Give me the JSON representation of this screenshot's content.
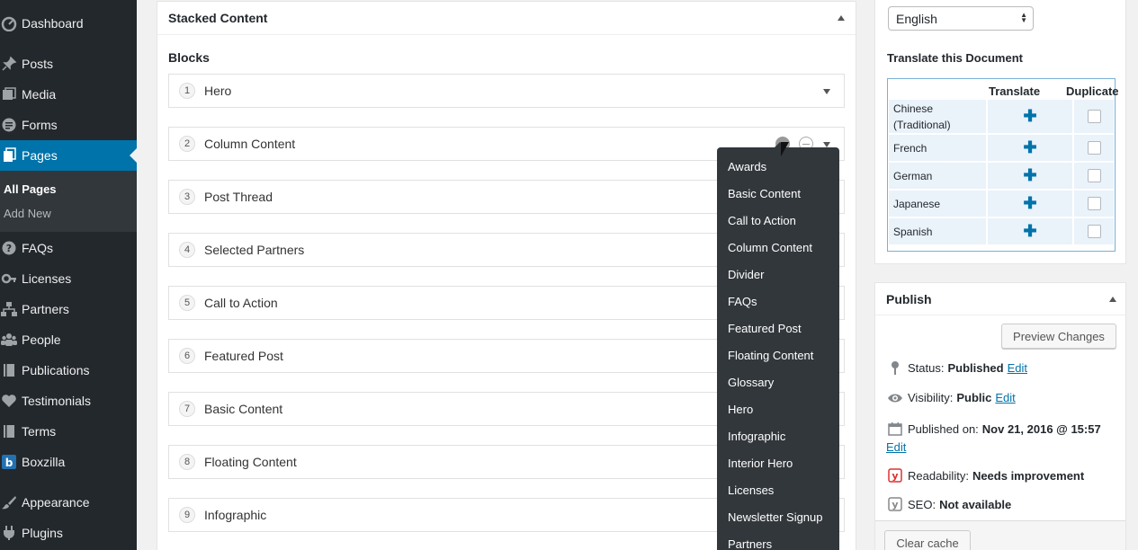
{
  "sidebar": {
    "items": [
      {
        "label": "Dashboard",
        "icon": "dashboard-icon"
      },
      {
        "label": "Posts",
        "icon": "pin-icon"
      },
      {
        "label": "Media",
        "icon": "media-icon"
      },
      {
        "label": "Forms",
        "icon": "forms-icon"
      },
      {
        "label": "Pages",
        "icon": "pages-icon"
      },
      {
        "label": "FAQs",
        "icon": "question-icon"
      },
      {
        "label": "Licenses",
        "icon": "key-icon"
      },
      {
        "label": "Partners",
        "icon": "network-icon"
      },
      {
        "label": "People",
        "icon": "groups-icon"
      },
      {
        "label": "Publications",
        "icon": "book-icon"
      },
      {
        "label": "Testimonials",
        "icon": "heart-icon"
      },
      {
        "label": "Terms",
        "icon": "book-icon"
      },
      {
        "label": "Boxzilla",
        "icon": "boxzilla-icon"
      },
      {
        "label": "Appearance",
        "icon": "paintbrush-icon"
      },
      {
        "label": "Plugins",
        "icon": "plugin-icon"
      }
    ],
    "submenu": {
      "all_pages": "All Pages",
      "add_new": "Add New"
    }
  },
  "main": {
    "box_title": "Stacked Content",
    "blocks_label": "Blocks",
    "blocks": [
      {
        "num": "1",
        "title": "Hero"
      },
      {
        "num": "2",
        "title": "Column Content"
      },
      {
        "num": "3",
        "title": "Post Thread"
      },
      {
        "num": "4",
        "title": "Selected Partners"
      },
      {
        "num": "5",
        "title": "Call to Action"
      },
      {
        "num": "6",
        "title": "Featured Post"
      },
      {
        "num": "7",
        "title": "Basic Content"
      },
      {
        "num": "8",
        "title": "Floating Content"
      },
      {
        "num": "9",
        "title": "Infographic"
      }
    ],
    "dropdown": [
      "Awards",
      "Basic Content",
      "Call to Action",
      "Column Content",
      "Divider",
      "FAQs",
      "Featured Post",
      "Floating Content",
      "Glossary",
      "Hero",
      "Infographic",
      "Interior Hero",
      "Licenses",
      "Newsletter Signup",
      "Partners"
    ]
  },
  "language": {
    "selected": "English",
    "translate_heading": "Translate this Document",
    "col_translate": "Translate",
    "col_duplicate": "Duplicate",
    "languages": [
      "Chinese (Traditional)",
      "French",
      "German",
      "Japanese",
      "Spanish"
    ]
  },
  "publish": {
    "title": "Publish",
    "preview_button": "Preview Changes",
    "status_label": "Status:",
    "status_value": "Published",
    "visibility_label": "Visibility:",
    "visibility_value": "Public",
    "published_on_label": "Published on:",
    "published_on_value": "Nov 21, 2016 @ 15:57",
    "readability_label": "Readability:",
    "readability_value": "Needs improvement",
    "seo_label": "SEO:",
    "seo_value": "Not available",
    "edit_label": "Edit",
    "clear_cache": "Clear cache"
  },
  "colors": {
    "sidebar_bg": "#23282d",
    "accent": "#0073aa",
    "dropdown_bg": "#32373c",
    "readability_red": "#dc3232"
  }
}
